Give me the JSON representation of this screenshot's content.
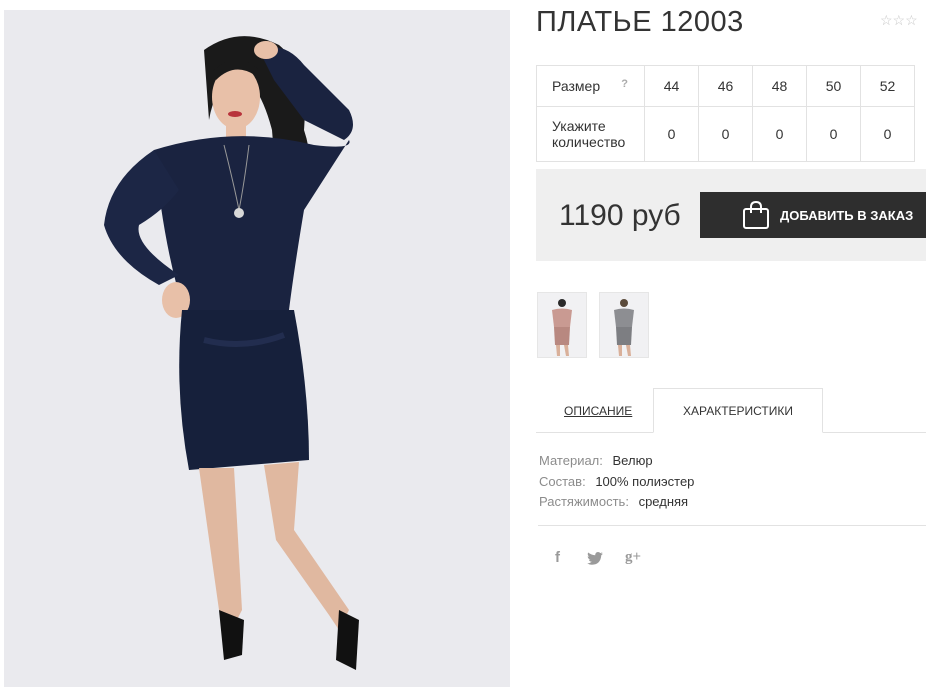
{
  "product": {
    "title": "ПЛАТЬЕ 12003",
    "rating_stars": "☆☆☆",
    "size_table": {
      "size_label": "Размер",
      "help": "?",
      "sizes": [
        "44",
        "46",
        "48",
        "50",
        "52"
      ],
      "qty_label_line1": "Укажите",
      "qty_label_line2": "количество",
      "quantities": [
        "0",
        "0",
        "0",
        "0",
        "0"
      ]
    },
    "price": "1190 руб",
    "add_button": "ДОБАВИТЬ В ЗАКАЗ"
  },
  "tabs": {
    "description": "ОПИСАНИЕ",
    "characteristics": "ХАРАКТЕРИСТИКИ",
    "active": "characteristics"
  },
  "characteristics": [
    {
      "key": "Материал:",
      "value": "Велюр"
    },
    {
      "key": "Состав:",
      "value": "100% полиэстер"
    },
    {
      "key": "Растяжимость:",
      "value": "средняя"
    }
  ],
  "social": {
    "facebook": "f",
    "google": "g+"
  },
  "colors": {
    "dress": "#1a2340",
    "button": "#2e2e2e",
    "panel": "#efefef",
    "thumb_pink": "#c99a92",
    "thumb_grey": "#8d8e92"
  }
}
